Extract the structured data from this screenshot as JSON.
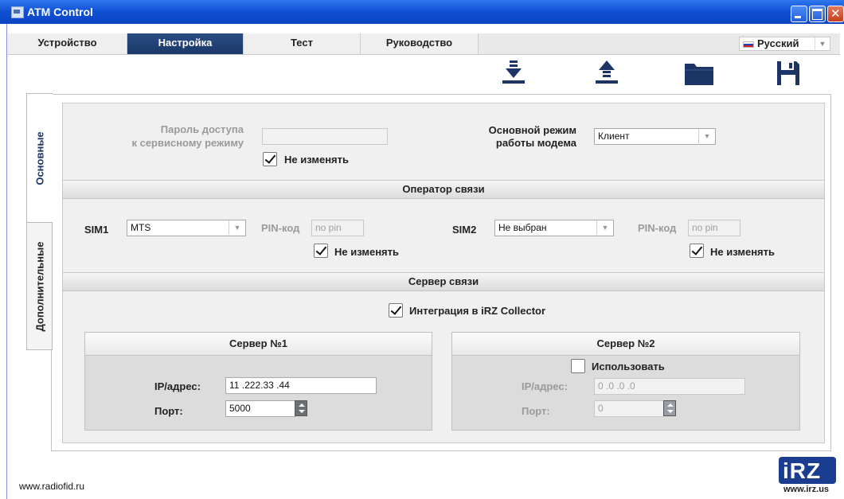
{
  "window": {
    "title": "ATM Control"
  },
  "tabs": [
    {
      "label": "Устройство",
      "active": false
    },
    {
      "label": "Настройка",
      "active": true
    },
    {
      "label": "Тест",
      "active": false
    },
    {
      "label": "Руководство",
      "active": false
    }
  ],
  "language": {
    "selected": "Русский"
  },
  "toolbar": [
    "download-icon",
    "upload-icon",
    "folder-icon",
    "save-icon"
  ],
  "side_tabs": {
    "basic": "Основные",
    "advanced": "Дополнительные"
  },
  "access": {
    "password_label_1": "Пароль доступа",
    "password_label_2": "к сервисному режиму",
    "password_value": "",
    "keep_label": "Не изменять",
    "keep_checked": true
  },
  "mode": {
    "label_1": "Основной режим",
    "label_2": "работы модема",
    "value": "Клиент"
  },
  "operator": {
    "title": "Оператор связи",
    "sim1": {
      "label": "SIM1",
      "value": "MTS",
      "pin_label": "PIN-код",
      "pin_placeholder": "no pin",
      "keep_label": "Не изменять",
      "keep_checked": true
    },
    "sim2": {
      "label": "SIM2",
      "value": "Не выбран",
      "pin_label": "PIN-код",
      "pin_placeholder": "no pin",
      "keep_label": "Не изменять",
      "keep_checked": true
    }
  },
  "server": {
    "title": "Сервер связи",
    "collector_label": "Интеграция в iRZ Collector",
    "collector_checked": true,
    "server1": {
      "title": "Сервер №1",
      "ip_label": "IP/адрес:",
      "ip_value": "11 .222.33 .44",
      "port_label": "Порт:",
      "port_value": "5000"
    },
    "server2": {
      "title": "Сервер №2",
      "use_label": "Использовать",
      "use_checked": false,
      "ip_label": "IP/адрес:",
      "ip_value": "0 .0 .0 .0",
      "port_label": "Порт:",
      "port_value": "0"
    }
  },
  "footer": {
    "site": "www.radiofid.ru"
  },
  "logo": {
    "text": "iRZ",
    "url": "www.irz.us"
  },
  "colors": {
    "titlebar": "#1252d6",
    "active_tab": "#1b3868",
    "logo": "#1b3d8f"
  }
}
